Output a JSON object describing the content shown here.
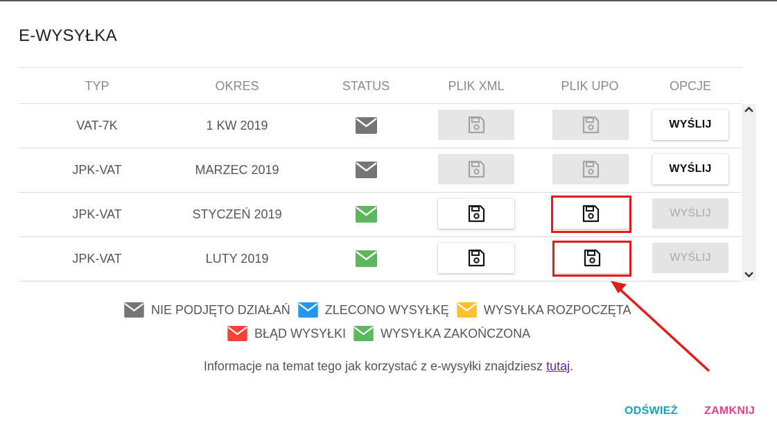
{
  "dialog": {
    "title": "E-WYSYŁKA"
  },
  "table": {
    "columns": [
      "TYP",
      "OKRES",
      "STATUS",
      "PLIK XML",
      "PLIK UPO",
      "OPCJE"
    ],
    "rows": [
      {
        "type": "VAT-7K",
        "period": "1 KW 2019",
        "status_color": "#757575",
        "xml_enabled": false,
        "upo_enabled": false,
        "send_label": "WYŚLIJ",
        "send_enabled": true
      },
      {
        "type": "JPK-VAT",
        "period": "MARZEC 2019",
        "status_color": "#757575",
        "xml_enabled": false,
        "upo_enabled": false,
        "send_label": "WYŚLIJ",
        "send_enabled": true
      },
      {
        "type": "JPK-VAT",
        "period": "STYCZEŃ 2019",
        "status_color": "#5cb85c",
        "xml_enabled": true,
        "upo_enabled": true,
        "send_label": "WYŚLIJ",
        "send_enabled": false
      },
      {
        "type": "JPK-VAT",
        "period": "LUTY 2019",
        "status_color": "#5cb85c",
        "xml_enabled": true,
        "upo_enabled": true,
        "send_label": "WYŚLIJ",
        "send_enabled": false
      }
    ]
  },
  "legend": {
    "items": [
      {
        "label": "NIE PODJĘTO DZIAŁAŃ",
        "color": "#757575"
      },
      {
        "label": "ZLECONO WYSYŁKĘ",
        "color": "#2196f3"
      },
      {
        "label": "WYSYŁKA ROZPOCZĘTA",
        "color": "#fbc02d"
      },
      {
        "label": "BŁĄD WYSYŁKI",
        "color": "#f44336"
      },
      {
        "label": "WYSYŁKA ZAKOŃCZONA",
        "color": "#5cb85c"
      }
    ]
  },
  "info": {
    "text": "Informacje na temat tego jak korzystać z e-wysyłki znajdziesz ",
    "link": "tutaj",
    "suffix": "."
  },
  "footer": {
    "refresh_label": "ODŚWIEŻ",
    "refresh_color": "#17a2b8",
    "close_label": "ZAMKNIJ",
    "close_color": "#e83e8c"
  },
  "annotation_color": "#e41b1b"
}
